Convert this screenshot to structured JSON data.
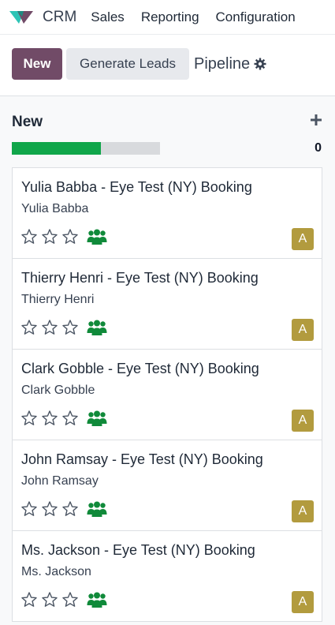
{
  "navbar": {
    "app_icon": "crm-logo-icon",
    "app_name": "CRM",
    "menu": [
      {
        "label": "Sales"
      },
      {
        "label": "Reporting"
      },
      {
        "label": "Configuration"
      }
    ]
  },
  "control_panel": {
    "new_label": "New",
    "generate_leads_label": "Generate Leads",
    "breadcrumb": "Pipeline",
    "settings_icon": "gear-icon"
  },
  "column": {
    "title": "New",
    "add_icon": "plus-icon",
    "progress_fraction": 0.6,
    "count": "0",
    "colors": {
      "progress": "#10a64a",
      "track": "#d8dadd"
    }
  },
  "cards": [
    {
      "title": "Yulia Babba - Eye Test (NY) Booking",
      "contact": "Yulia Babba",
      "rating": 0,
      "avatar": "A"
    },
    {
      "title": "Thierry Henri - Eye Test (NY) Booking",
      "contact": "Thierry Henri",
      "rating": 0,
      "avatar": "A"
    },
    {
      "title": "Clark Gobble - Eye Test (NY) Booking",
      "contact": "Clark Gobble",
      "rating": 0,
      "avatar": "A"
    },
    {
      "title": "John Ramsay - Eye Test (NY) Booking",
      "contact": "John Ramsay",
      "rating": 0,
      "avatar": "A"
    },
    {
      "title": "Ms. Jackson - Eye Test (NY) Booking",
      "contact": "Ms. Jackson",
      "rating": 0,
      "avatar": "A"
    }
  ],
  "colors": {
    "primary": "#714b67",
    "avatar": "#b29b3e",
    "team_icon": "#108a3a"
  }
}
